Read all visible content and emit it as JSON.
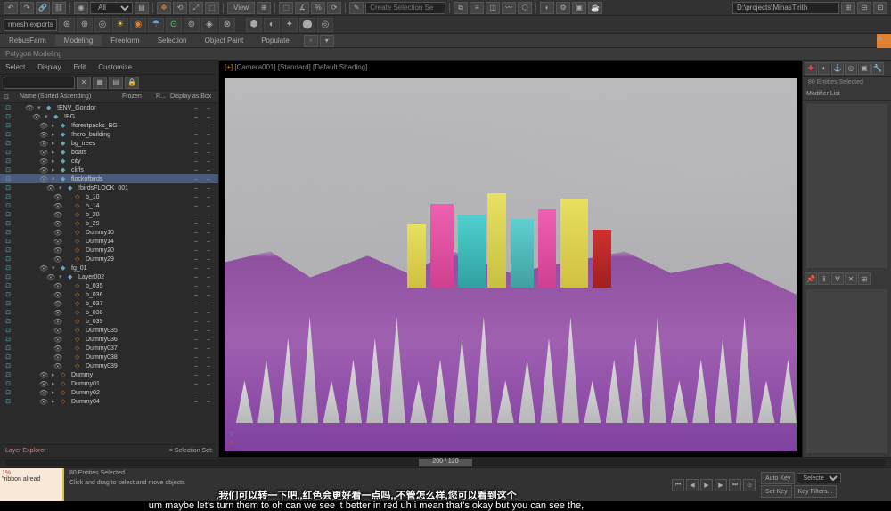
{
  "toolbar": {
    "dropdown1": "All",
    "search_placeholder": "",
    "view_label": "View",
    "selection_placeholder": "Create Selection Se",
    "path": "D:\\projects\\MinasTirith"
  },
  "ribbon": {
    "tabs": [
      "RebusFarm",
      "Modeling",
      "Freeform",
      "Selection",
      "Object Paint",
      "Populate"
    ],
    "active": 1,
    "subtitle": "Polygon Modeling"
  },
  "outliner": {
    "menu": [
      "Select",
      "Display",
      "Edit",
      "Customize"
    ],
    "header": {
      "name": "Name (Sorted Ascending)",
      "frozen": "Frozen",
      "r": "R...",
      "display": "Display as Box"
    },
    "items": [
      {
        "name": "!ENV_Gondor",
        "depth": 1,
        "expand": "▾",
        "icon": "◆"
      },
      {
        "name": "!BG",
        "depth": 2,
        "expand": "▾",
        "icon": "◆"
      },
      {
        "name": "!forestpacks_BG",
        "depth": 3,
        "expand": "▸",
        "icon": "◆"
      },
      {
        "name": "!hero_building",
        "depth": 3,
        "expand": "▸",
        "icon": "◆"
      },
      {
        "name": "bg_trees",
        "depth": 3,
        "expand": "▸",
        "icon": "◆"
      },
      {
        "name": "boats",
        "depth": 3,
        "expand": "▸",
        "icon": "◆"
      },
      {
        "name": "city",
        "depth": 3,
        "expand": "▸",
        "icon": "◆"
      },
      {
        "name": "cliffs",
        "depth": 3,
        "expand": "▸",
        "icon": "◆"
      },
      {
        "name": "flockofbirds",
        "depth": 3,
        "expand": "▾",
        "icon": "◆",
        "selected": true
      },
      {
        "name": "!birdsFLOCK_001",
        "depth": 4,
        "expand": "▾",
        "icon": "◆"
      },
      {
        "name": "b_10",
        "depth": 5,
        "expand": "",
        "icon": "◇"
      },
      {
        "name": "b_14",
        "depth": 5,
        "expand": "",
        "icon": "◇"
      },
      {
        "name": "b_20",
        "depth": 5,
        "expand": "",
        "icon": "◇"
      },
      {
        "name": "b_29",
        "depth": 5,
        "expand": "",
        "icon": "◇"
      },
      {
        "name": "Dummy10",
        "depth": 5,
        "expand": "",
        "icon": "◇"
      },
      {
        "name": "Dummy14",
        "depth": 5,
        "expand": "",
        "icon": "◇"
      },
      {
        "name": "Dummy20",
        "depth": 5,
        "expand": "",
        "icon": "◇"
      },
      {
        "name": "Dummy29",
        "depth": 5,
        "expand": "",
        "icon": "◇"
      },
      {
        "name": "fg_01",
        "depth": 3,
        "expand": "▾",
        "icon": "◆"
      },
      {
        "name": "Layer002",
        "depth": 4,
        "expand": "▾",
        "icon": "◆"
      },
      {
        "name": "b_035",
        "depth": 5,
        "expand": "",
        "icon": "◇"
      },
      {
        "name": "b_036",
        "depth": 5,
        "expand": "",
        "icon": "◇"
      },
      {
        "name": "b_037",
        "depth": 5,
        "expand": "",
        "icon": "◇"
      },
      {
        "name": "b_038",
        "depth": 5,
        "expand": "",
        "icon": "◇"
      },
      {
        "name": "b_039",
        "depth": 5,
        "expand": "",
        "icon": "◇"
      },
      {
        "name": "Dummy035",
        "depth": 5,
        "expand": "",
        "icon": "◇"
      },
      {
        "name": "Dummy036",
        "depth": 5,
        "expand": "",
        "icon": "◇"
      },
      {
        "name": "Dummy037",
        "depth": 5,
        "expand": "",
        "icon": "◇"
      },
      {
        "name": "Dummy038",
        "depth": 5,
        "expand": "",
        "icon": "◇"
      },
      {
        "name": "Dummy039",
        "depth": 5,
        "expand": "",
        "icon": "◇"
      },
      {
        "name": "Dummy",
        "depth": 3,
        "expand": "▸",
        "icon": "◇"
      },
      {
        "name": "Dummy01",
        "depth": 3,
        "expand": "▸",
        "icon": "◇"
      },
      {
        "name": "Dummy02",
        "depth": 3,
        "expand": "▸",
        "icon": "◇"
      },
      {
        "name": "Dummy04",
        "depth": 3,
        "expand": "▸",
        "icon": "◇"
      }
    ],
    "footer_left": "Layer Explorer",
    "footer_right": "Selection Set:"
  },
  "viewport": {
    "label_bracket": "[+]",
    "label": "[Camera001] [Standard] [Default Shading]"
  },
  "right_panel": {
    "selected_label": "80 Entities Selected",
    "modifier_label": "Modifier List"
  },
  "timeline": {
    "value": "200 / 120"
  },
  "status": {
    "maxscript": "rmesh exports",
    "ribbon_text": "\"ribbon alread",
    "entities": "80 Entities Selected",
    "hint": "Click and drag to select and move objects",
    "autokey": "Auto Key",
    "selected_opt": "Selected",
    "setkey": "Set Key",
    "keyfilters": "Key Filters..."
  },
  "subtitles": {
    "cn": ",我们可以转一下吧,,红色会更好看一点吗,,不管怎么样,您可以看到这个",
    "en": "um maybe let's turn them to oh can we see it better in red uh i mean that's okay but you can see the,"
  }
}
